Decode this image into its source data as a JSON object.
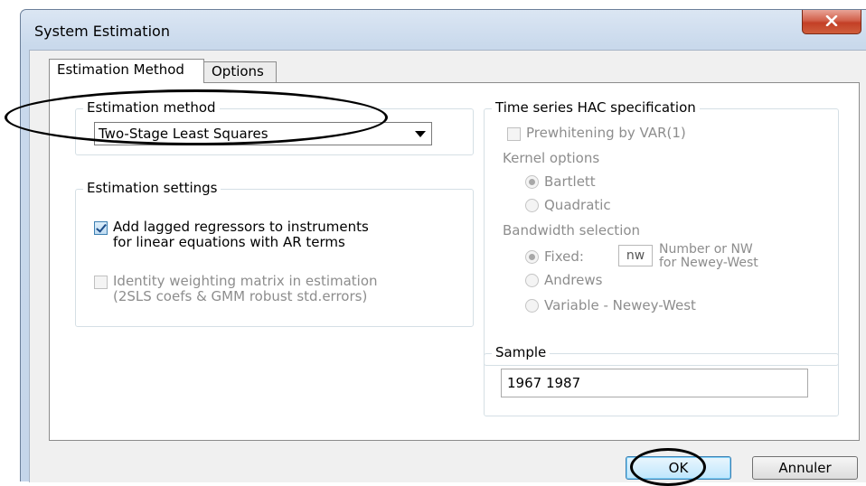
{
  "window": {
    "title": "System Estimation",
    "close_label": "x"
  },
  "tabs": [
    {
      "label": "Estimation Method",
      "active": true
    },
    {
      "label": "Options",
      "active": false
    }
  ],
  "estimation_method": {
    "legend": "Estimation method",
    "selected": "Two-Stage Least Squares"
  },
  "estimation_settings": {
    "legend": "Estimation settings",
    "add_lagged": {
      "line1": "Add lagged regressors to instruments",
      "line2": "for linear equations with AR terms",
      "checked": true,
      "enabled": true
    },
    "identity_weighting": {
      "line1": "Identity weighting matrix in estimation",
      "line2": "(2SLS coefs & GMM robust std.errors)",
      "checked": false,
      "enabled": false
    }
  },
  "hac": {
    "legend": "Time series HAC specification",
    "prewhitening": "Prewhitening by VAR(1)",
    "kernel_label": "Kernel options",
    "kernel_options": [
      {
        "label": "Bartlett",
        "selected": true
      },
      {
        "label": "Quadratic",
        "selected": false
      }
    ],
    "bandwidth_label": "Bandwidth selection",
    "fixed_label": "Fixed:",
    "fixed_value": "nw",
    "fixed_hint_line1": "Number or NW",
    "fixed_hint_line2": "for Newey-West",
    "andrews_label": "Andrews",
    "variable_label": "Variable - Newey-West"
  },
  "sample": {
    "legend": "Sample",
    "value": "1967 1987"
  },
  "buttons": {
    "ok": "OK",
    "cancel": "Annuler"
  },
  "colors": {
    "accent": "#3c7fb1",
    "title_bar": "#c9d9ec",
    "close": "#c33f26"
  },
  "icons": {
    "close": "close-icon",
    "dropdown": "chevron-down-icon"
  }
}
